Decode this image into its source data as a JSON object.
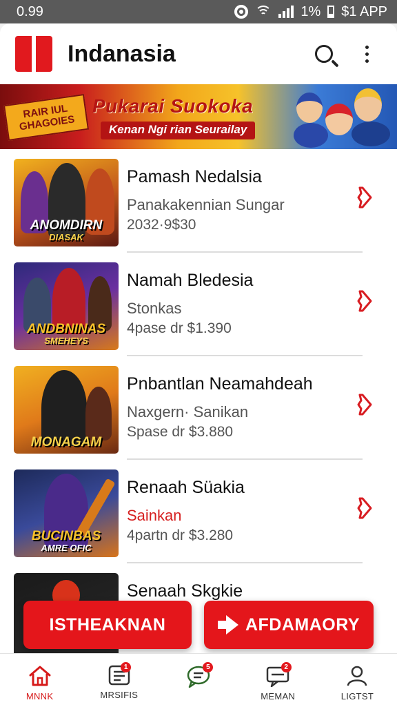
{
  "status_bar": {
    "left": "0.99",
    "battery": "1%",
    "right": "$1 APP"
  },
  "header": {
    "title": "Indanasia",
    "icons": [
      "app-logo",
      "search-icon",
      "more-icon"
    ]
  },
  "banner": {
    "tag_line1": "RAIR IUL",
    "tag_line2": "GHAGOIES",
    "headline": "Pukarai Suokoka",
    "sub": "Kenan Ngi rian Seurailay"
  },
  "items": [
    {
      "title": "Pamash Nedalsia",
      "subtitle": "Panakakennian Sungar",
      "price": "2032·9$30",
      "thumb_line1": "ANOMDIRN",
      "thumb_line2": "DIASAK",
      "subtitle_red": false
    },
    {
      "title": "Namah Bledesia",
      "subtitle": "Stonkas",
      "price": "4pase dr $1.390",
      "thumb_line1": "ANDBNINAS",
      "thumb_line2": "SMEHEYS",
      "subtitle_red": false
    },
    {
      "title": "Pnbantlan Neamahdeah",
      "subtitle": "Naxgern· Sanikan",
      "price": "Spase dr $3.880",
      "thumb_line1": "MONAGAM",
      "thumb_line2": "",
      "subtitle_red": false
    },
    {
      "title": "Renaah Süakia",
      "subtitle": "Sainkan",
      "price": "4partn dr $3.280",
      "thumb_line1": "BUCINBAS",
      "thumb_line2": "AMRE OFIC",
      "subtitle_red": true
    },
    {
      "title": "Senaah Skgkie",
      "subtitle": "",
      "price": "",
      "thumb_line1": "",
      "thumb_line2": "",
      "subtitle_red": false
    }
  ],
  "actions": {
    "left_label": "ISTHEAKNAN",
    "right_label": "AFDAMAORY"
  },
  "nav": [
    {
      "label": "MNNK",
      "icon": "home-icon",
      "badge": ""
    },
    {
      "label": "MRSIFIS",
      "icon": "list-icon",
      "badge": "1"
    },
    {
      "label": "",
      "icon": "chat-icon",
      "badge": "5"
    },
    {
      "label": "MEMAN",
      "icon": "message-icon",
      "badge": "2"
    },
    {
      "label": "LIGTST",
      "icon": "user-icon",
      "badge": ""
    }
  ],
  "colors": {
    "accent": "#e4161b",
    "text": "#111111",
    "muted": "#555555"
  }
}
